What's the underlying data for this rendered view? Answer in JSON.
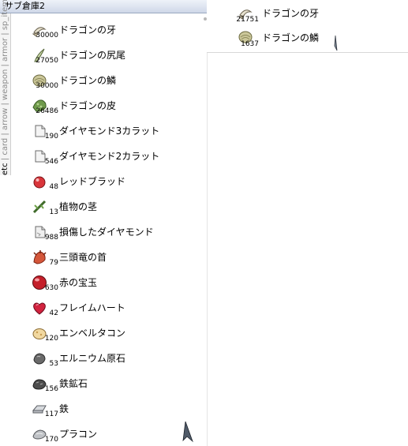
{
  "window": {
    "title": "サブ倉庫2",
    "tabs": [
      "etc",
      "card",
      "arrow",
      "weapon",
      "armor",
      "sp_item"
    ],
    "active_tab": "etc"
  },
  "storage_items": [
    {
      "count": "30000",
      "name": "ドラゴンの牙",
      "icon": "dragon-fang-icon"
    },
    {
      "count": "27050",
      "name": "ドラゴンの尻尾",
      "icon": "dragon-tail-icon"
    },
    {
      "count": "30000",
      "name": "ドラゴンの鱗",
      "icon": "dragon-scale-icon"
    },
    {
      "count": "26486",
      "name": "ドラゴンの皮",
      "icon": "dragon-skin-icon"
    },
    {
      "count": "190",
      "name": "ダイヤモンド3カラット",
      "icon": "diamond-icon"
    },
    {
      "count": "546",
      "name": "ダイヤモンド2カラット",
      "icon": "diamond-icon"
    },
    {
      "count": "48",
      "name": "レッドブラッド",
      "icon": "red-blood-icon"
    },
    {
      "count": "13",
      "name": "植物の茎",
      "icon": "plant-stem-icon"
    },
    {
      "count": "988",
      "name": "損傷したダイヤモンド",
      "icon": "damaged-diamond-icon"
    },
    {
      "count": "79",
      "name": "三頭竜の首",
      "icon": "dragon-head-icon"
    },
    {
      "count": "630",
      "name": "赤の宝玉",
      "icon": "red-orb-icon"
    },
    {
      "count": "42",
      "name": "フレイムハート",
      "icon": "flame-heart-icon"
    },
    {
      "count": "120",
      "name": "エンベルタコン",
      "icon": "elunium-stone-icon"
    },
    {
      "count": "53",
      "name": "エルニウム原石",
      "icon": "rough-elunium-icon"
    },
    {
      "count": "156",
      "name": "鉄鉱石",
      "icon": "iron-ore-icon"
    },
    {
      "count": "117",
      "name": "鉄",
      "icon": "iron-icon"
    },
    {
      "count": "170",
      "name": "プラコン",
      "icon": "phracon-icon"
    }
  ],
  "inventory_items": [
    {
      "count": "21751",
      "name": "ドラゴンの牙",
      "icon": "dragon-fang-icon"
    },
    {
      "count": "1637",
      "name": "ドラゴンの鱗",
      "icon": "dragon-scale-icon"
    }
  ],
  "colors": {
    "titlebar": "#cfd8e8",
    "background": "#ffffff",
    "text": "#000000",
    "inactive_tab_text": "#8c8c8c"
  }
}
